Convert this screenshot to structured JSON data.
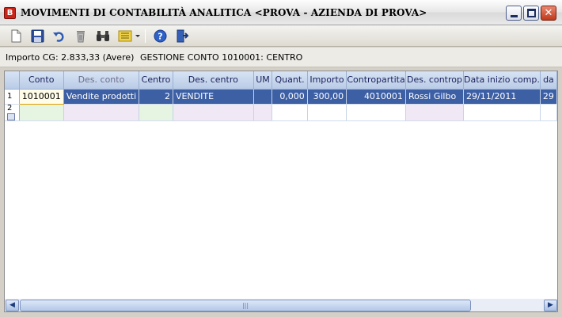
{
  "window": {
    "app_icon_letter": "B",
    "title": "MOVIMENTI DI CONTABILITÀ ANALITICA <PROVA - AZIENDA DI PROVA>",
    "close_glyph": "✕"
  },
  "toolbar": {
    "icons": [
      "new-document-icon",
      "save-icon",
      "undo-icon",
      "delete-icon",
      "find-icon",
      "list-options-icon",
      "help-icon",
      "exit-icon"
    ]
  },
  "info": {
    "importo": "Importo CG: 2.833,33 (Avere)",
    "gestione": "GESTIONE CONTO 1010001: CENTRO"
  },
  "grid": {
    "columns": [
      "Conto",
      "Des. conto",
      "Centro",
      "Des. centro",
      "UM",
      "Quant.",
      "Importo",
      "Contropartita",
      "Des. controp",
      "Data inizio comp.",
      "da"
    ],
    "rows": [
      {
        "num": "1",
        "conto": "1010001",
        "des_conto": "Vendite prodotti",
        "centro": "2",
        "des_centro": "VENDITE",
        "um": "",
        "quant": "0,000",
        "importo": "300,00",
        "contropartita": "4010001",
        "des_controp": "Rossi Gilbo",
        "data_inizio": "29/11/2011",
        "da": "29"
      },
      {
        "num": "2"
      }
    ]
  },
  "scrollbar": {
    "left_arrow": "◀",
    "right_arrow": "▶",
    "thumb_grip": "|||"
  }
}
